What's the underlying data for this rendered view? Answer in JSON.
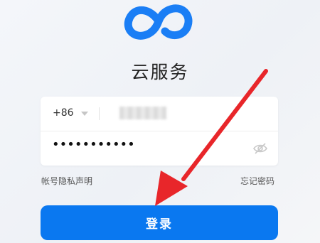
{
  "logo": {
    "icon": "infinity-cloud-logo",
    "color": "#1a7ef5"
  },
  "app": {
    "title": "云服务"
  },
  "form": {
    "country_code": "+86",
    "phone_value": "",
    "password_mask": "•••••••••••"
  },
  "links": {
    "privacy": "帐号隐私声明",
    "forgot": "忘记密码"
  },
  "login": {
    "label": "登录",
    "color": "#0a78f0"
  },
  "annotation": {
    "arrow_color": "#e8262a"
  }
}
